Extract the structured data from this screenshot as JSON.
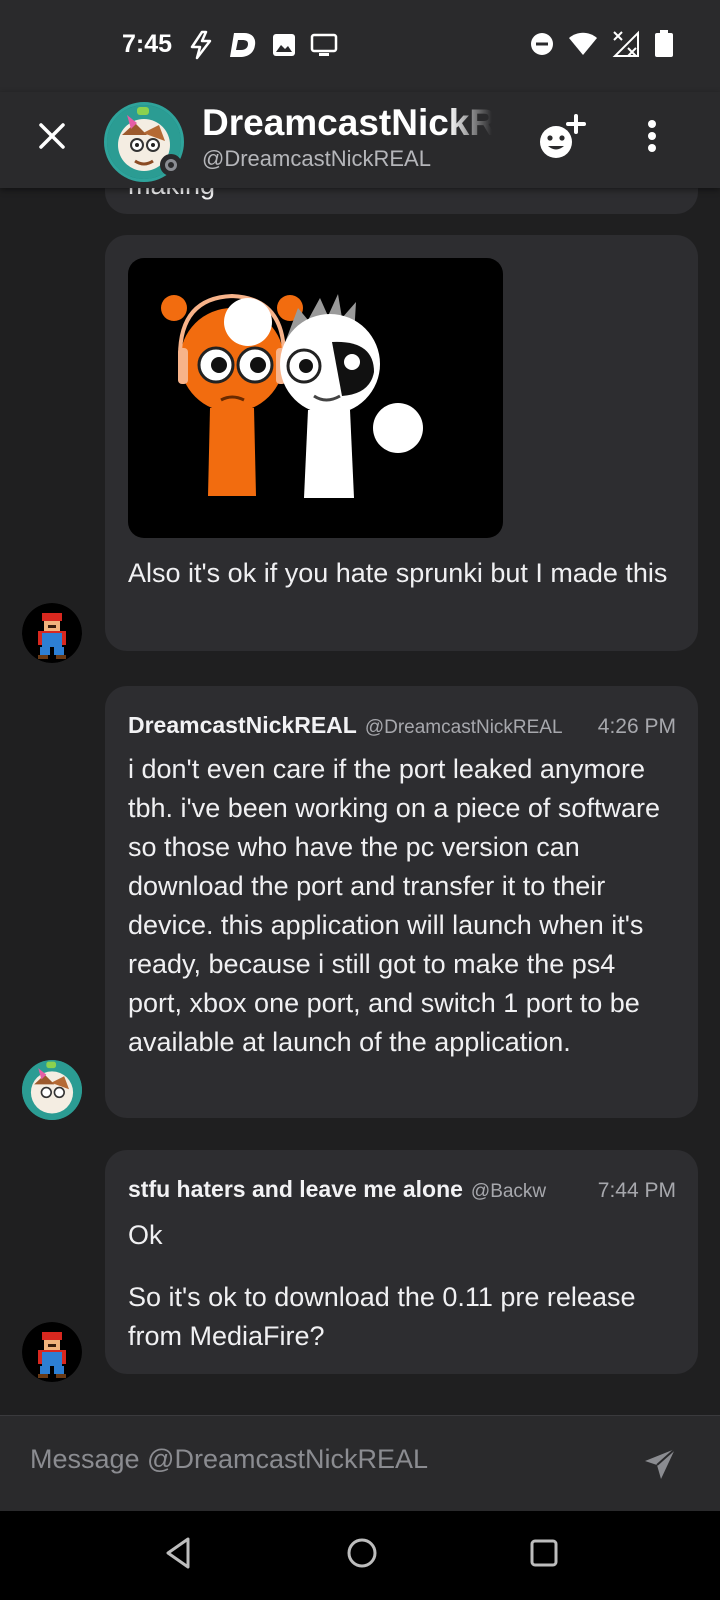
{
  "status_bar": {
    "time": "7:45",
    "icons_left": [
      "flash-icon",
      "d-app-icon",
      "image-icon",
      "cast-icon"
    ],
    "icons_right": [
      "dnd-icon",
      "wifi-icon",
      "no-signal-icon",
      "battery-icon"
    ]
  },
  "header": {
    "display_name": "DreamcastNickREAL",
    "handle": "@DreamcastNickREAL",
    "status": "offline"
  },
  "messages": {
    "partial_top": {
      "text": "making"
    },
    "image_message": {
      "text": "Also it's ok if you hate sprunki but I made this"
    },
    "dreamcast_message": {
      "author": "DreamcastNickREAL",
      "handle": "@DreamcastNickREAL",
      "time": "4:26 PM",
      "text": "i don't even care if the port leaked anymore tbh. i've been working on a piece of software so those who have the pc version can download the port and transfer it to their device. this application will launch when it's ready, because i still got to make the ps4 port, xbox one port, and switch 1 port to be available at launch of the application."
    },
    "stfu_message": {
      "author": "stfu haters and leave me alone",
      "handle": "@Backw",
      "time": "7:44 PM",
      "line1": "Ok",
      "line2": "So it's ok to download the 0.11 pre release from MediaFire?"
    }
  },
  "composer": {
    "placeholder": "Message @DreamcastNickREAL"
  },
  "colors": {
    "background": "#1f1f20",
    "bubble": "#2d2d30",
    "bar": "#2a2a2c",
    "sprunki_orange": "#f26c0f"
  }
}
